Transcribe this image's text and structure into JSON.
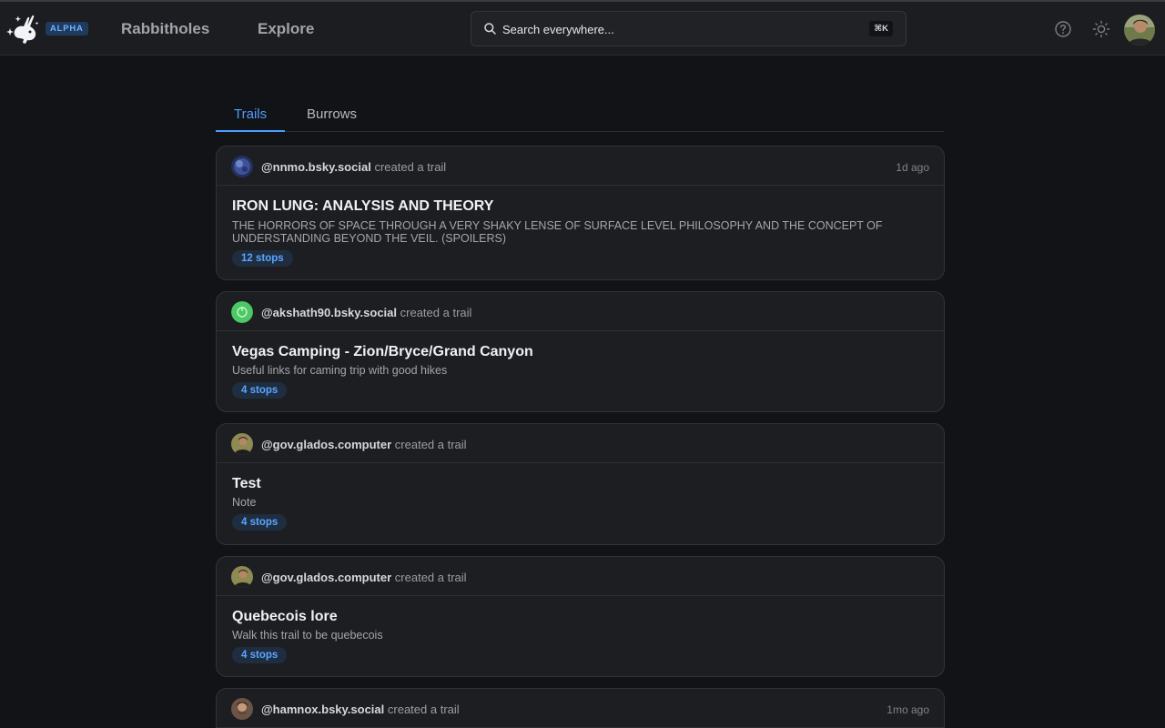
{
  "header": {
    "badge": "ALPHA",
    "nav": [
      "Rabbitholes",
      "Explore"
    ],
    "search_placeholder": "Search everywhere...",
    "search_shortcut": "⌘K"
  },
  "tabs": [
    "Trails",
    "Burrows"
  ],
  "feed": [
    {
      "user": "@nnmo.bsky.social",
      "action": "created a trail",
      "time": "1d ago",
      "title": "IRON LUNG: ANALYSIS AND THEORY",
      "description": "THE HORRORS OF SPACE THROUGH A VERY SHAKY LENSE OF SURFACE LEVEL PHILOSOPHY AND THE CONCEPT OF UNDERSTANDING BEYOND THE VEIL. (SPOILERS)",
      "stops": "12 stops"
    },
    {
      "user": "@akshath90.bsky.social",
      "action": "created a trail",
      "time": "",
      "title": "Vegas Camping - Zion/Bryce/Grand Canyon",
      "description": "Useful links for caming trip with good hikes",
      "stops": "4 stops"
    },
    {
      "user": "@gov.glados.computer",
      "action": "created a trail",
      "time": "",
      "title": "Test",
      "description": "Note",
      "stops": "4 stops"
    },
    {
      "user": "@gov.glados.computer",
      "action": "created a trail",
      "time": "",
      "title": "Quebecois lore",
      "description": "Walk this trail to be quebecois",
      "stops": "4 stops"
    },
    {
      "user": "@hamnox.bsky.social",
      "action": "created a trail",
      "time": "1mo ago",
      "title": "",
      "description": "",
      "stops": ""
    }
  ]
}
